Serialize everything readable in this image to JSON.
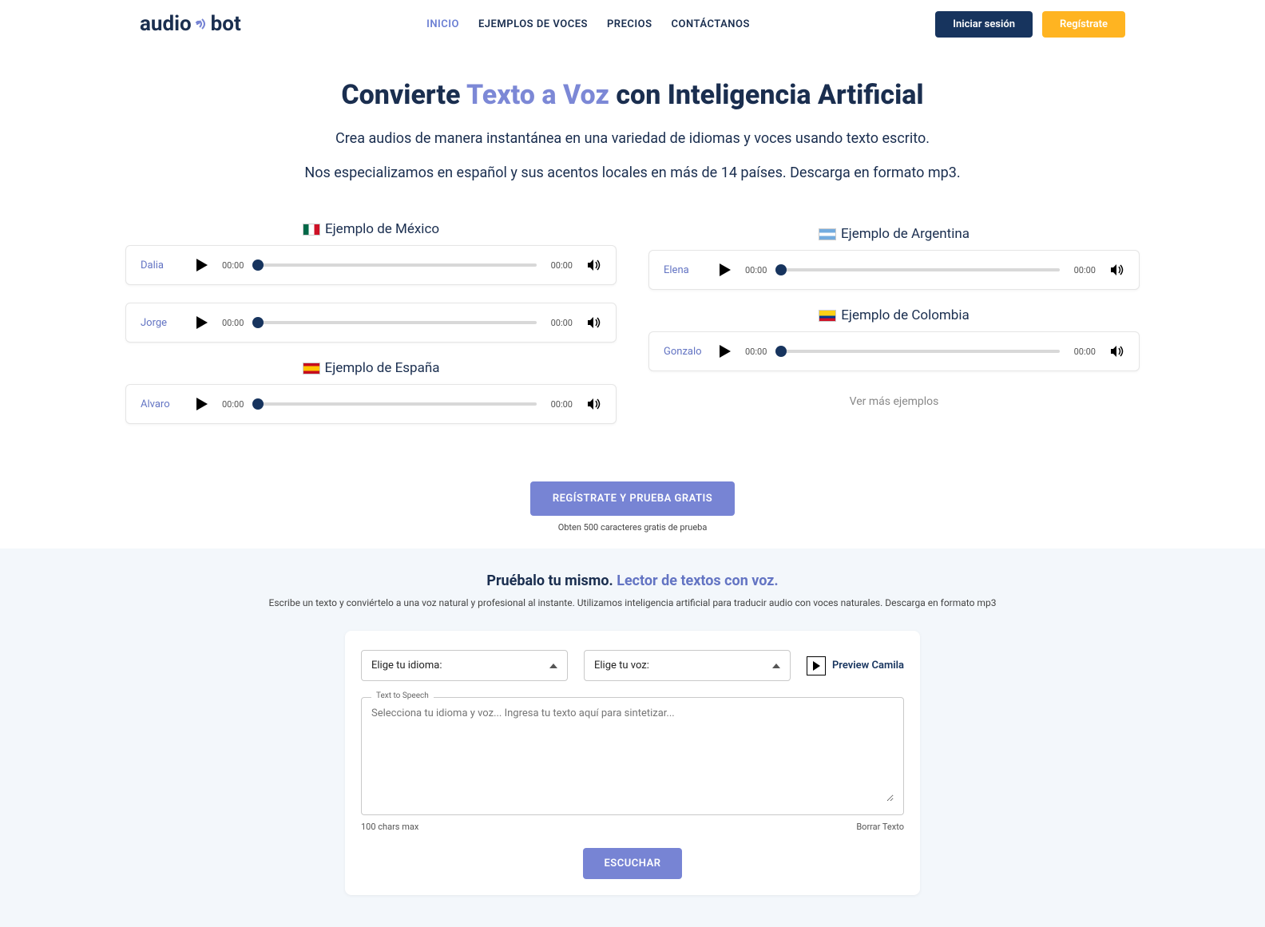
{
  "brand": {
    "logo_audio": "audio",
    "logo_bot": "bot"
  },
  "nav": {
    "inicio": "INICIO",
    "ejemplos": "EJEMPLOS DE VOCES",
    "precios": "PRECIOS",
    "contactanos": "CONTÁCTANOS"
  },
  "header_buttons": {
    "login": "Iniciar sesión",
    "register": "Regístrate"
  },
  "hero": {
    "title_pre": "Convierte ",
    "title_highlight": "Texto a Voz",
    "title_post": " con Inteligencia Artificial",
    "sub1": "Crea audios de manera instantánea en una variedad de idiomas y voces usando texto escrito.",
    "sub2": "Nos especializamos en español y sus acentos locales en más de 14 países. Descarga en formato mp3."
  },
  "examples": {
    "mexico": {
      "title": "Ejemplo de México",
      "voices": [
        {
          "name": "Dalia"
        },
        {
          "name": "Jorge"
        }
      ]
    },
    "espana": {
      "title": "Ejemplo de España",
      "voices": [
        {
          "name": "Alvaro"
        }
      ]
    },
    "argentina": {
      "title": "Ejemplo de Argentina",
      "voices": [
        {
          "name": "Elena"
        }
      ]
    },
    "colombia": {
      "title": "Ejemplo de Colombia",
      "voices": [
        {
          "name": "Gonzalo"
        }
      ]
    }
  },
  "player": {
    "t_start": "00:00",
    "t_end": "00:00"
  },
  "more_link": "Ver más ejemplos",
  "cta": {
    "label": "REGÍSTRATE Y PRUEBA GRATIS",
    "sub": "Obten 500 caracteres gratis de prueba"
  },
  "try": {
    "title_pre": "Pruébalo tu mismo. ",
    "title_hl": "Lector de textos con voz.",
    "sub": "Escribe un texto y conviértelo a una voz natural y profesional al instante. Utilizamos inteligencia artificial para traducir audio con voces naturales. Descarga en formato mp3",
    "select_lang": "Elige tu idioma:",
    "select_voice": "Elige tu voz:",
    "preview": "Preview Camila",
    "textarea_legend": "Text to Speech",
    "textarea_placeholder": "Selecciona tu idioma y voz... Ingresa tu texto aquí para sintetizar...",
    "chars": "100 chars max",
    "clear": "Borrar Texto",
    "listen": "ESCUCHAR"
  }
}
